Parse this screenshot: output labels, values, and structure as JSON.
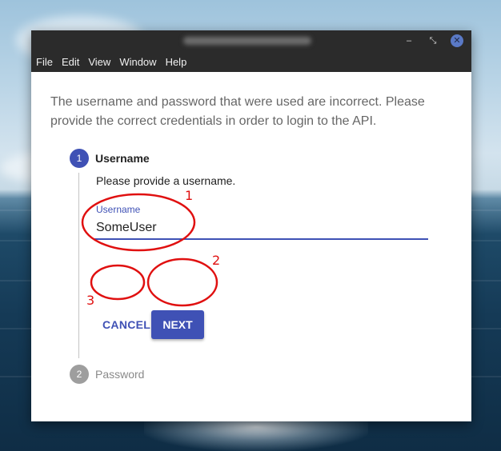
{
  "window": {
    "controls": {
      "minimize": "–",
      "maximize": "⤡",
      "close": "✕"
    }
  },
  "menu": [
    "File",
    "Edit",
    "View",
    "Window",
    "Help"
  ],
  "message": "The username and password that were used are incorrect. Please provide the correct credentials in order to login to the API.",
  "steps": [
    {
      "number": "1",
      "title": "Username",
      "state": "active"
    },
    {
      "number": "2",
      "title": "Password",
      "state": "inactive"
    }
  ],
  "username_step": {
    "description": "Please provide a username.",
    "field_label": "Username",
    "field_value": "SomeUser"
  },
  "buttons": {
    "cancel": "CANCEL",
    "next": "NEXT"
  },
  "annotations": [
    "1",
    "2",
    "3"
  ],
  "colors": {
    "primary": "#3f51b5",
    "annotation": "#e01010",
    "titlebar": "#2b2b2b"
  },
  "icons": {
    "minimize": "minimize-icon",
    "maximize": "maximize-icon",
    "close": "close-icon"
  }
}
